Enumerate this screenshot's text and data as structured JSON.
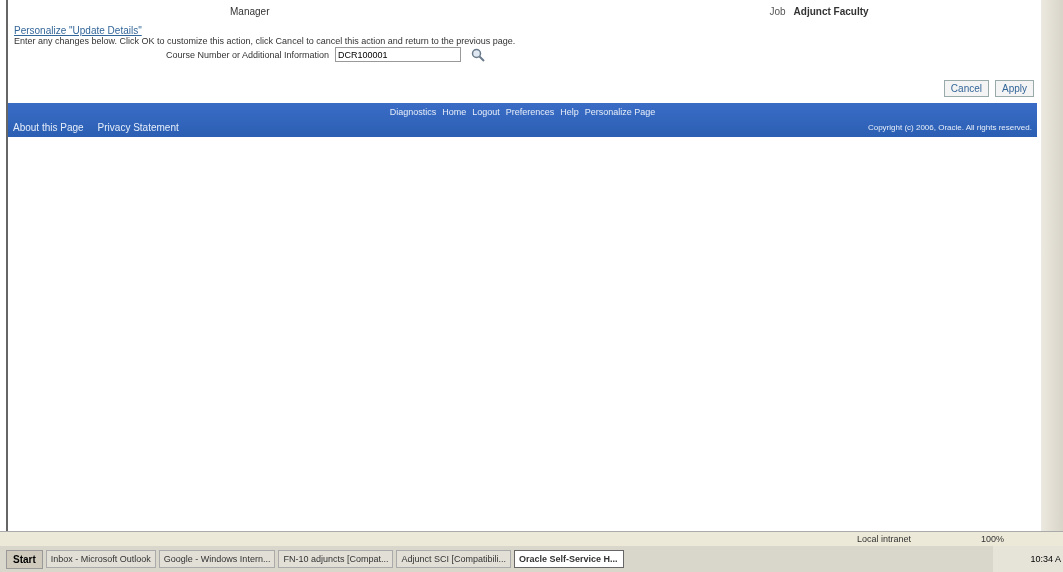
{
  "header": {
    "manager_label": "Manager",
    "job_label": "Job",
    "job_value": "Adjunct Faculty"
  },
  "personalize_link": "Personalize \"Update Details\"",
  "instructions": "Enter any changes below. Click OK to customize this action, click Cancel to cancel this action and return to the previous page.",
  "field": {
    "label": "Course Number or Additional Information",
    "value": "DCR100001"
  },
  "buttons": [
    "Cancel",
    "Apply"
  ],
  "footer": {
    "global_links": [
      "Diagnostics",
      "Home",
      "Logout",
      "Preferences",
      "Help",
      "Personalize Page"
    ],
    "links": [
      "About this Page",
      "Privacy Statement"
    ],
    "copyright": "Copyright (c) 2006, Oracle. All rights reserved."
  },
  "status_bar": {
    "zone": "Local intranet",
    "zoom": "100%"
  },
  "taskbar": {
    "start": "Start",
    "tasks": [
      {
        "label": "Inbox - Microsoft Outlook",
        "selected": false
      },
      {
        "label": "Google - Windows Intern...",
        "selected": false
      },
      {
        "label": "FN-10 adjuncts [Compat...",
        "selected": false
      },
      {
        "label": "Adjunct SCI [Compatibili...",
        "selected": false
      },
      {
        "label": "Oracle Self-Service H...",
        "selected": true
      }
    ],
    "clock": "10:34 A"
  }
}
